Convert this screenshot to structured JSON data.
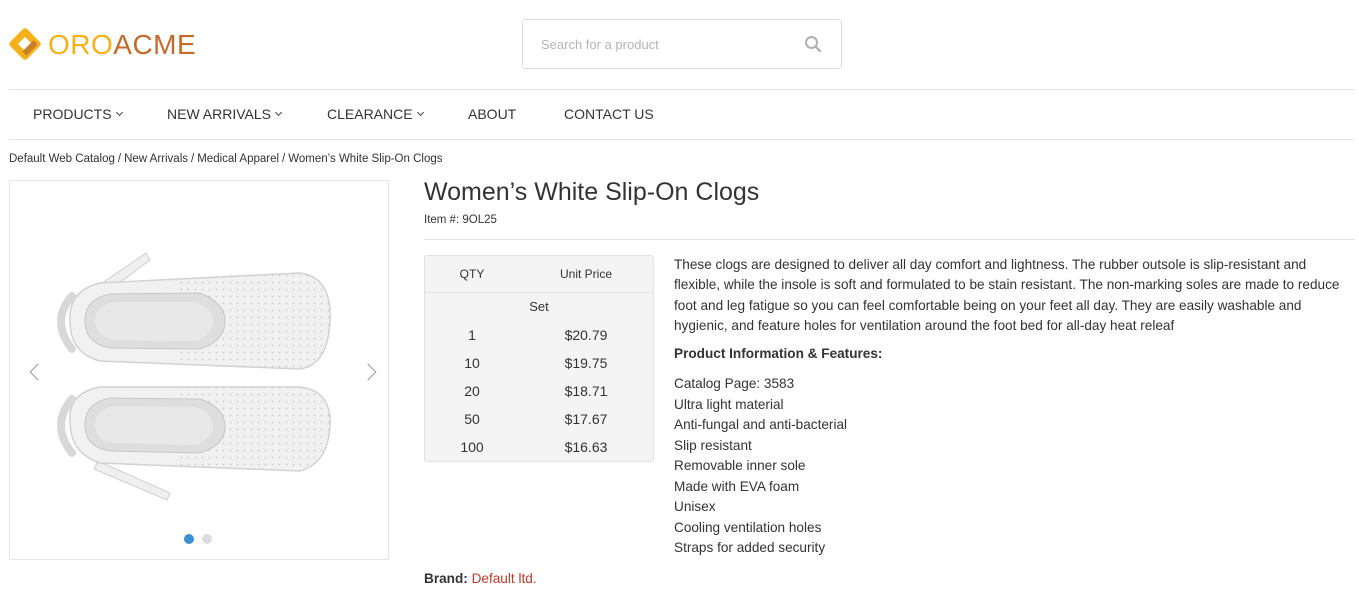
{
  "logo": {
    "part1": "ORO",
    "part2": "ACME"
  },
  "search": {
    "placeholder": "Search for a product"
  },
  "nav": {
    "products": "PRODUCTS",
    "new_arrivals": "NEW ARRIVALS",
    "clearance": "CLEARANCE",
    "about": "ABOUT",
    "contact": "CONTACT US"
  },
  "breadcrumb": [
    "Default Web Catalog",
    "New Arrivals",
    "Medical Apparel",
    "Women’s White Slip-On Clogs"
  ],
  "product": {
    "title": "Women’s White Slip-On Clogs",
    "item_label": "Item #:",
    "item_number": "9OL25",
    "description": "These clogs are designed to deliver all day comfort and lightness. The rubber outsole is slip-resistant and flexible, while the insole is soft and formulated to be stain resistant. The non-marking soles are made to reduce foot and leg fatigue so you can feel comfortable being on your feet all day. They are easily washable and hygienic, and feature holes for ventilation around the foot bed for all-day heat releaf",
    "features_title": "Product Information & Features:",
    "features": [
      "Catalog Page: 3583",
      "Ultra light material",
      "Anti-fungal and anti-bacterial",
      "Slip resistant",
      "Removable inner sole",
      "Made with EVA foam",
      "Unisex",
      "Cooling ventilation holes",
      "Straps for added security"
    ],
    "brand_label": "Brand:",
    "brand_value": "Default ltd."
  },
  "pricing": {
    "qty_header": "QTY",
    "price_header": "Unit Price",
    "unit": "Set",
    "rows": [
      {
        "qty": "1",
        "price": "$20.79"
      },
      {
        "qty": "10",
        "price": "$19.75"
      },
      {
        "qty": "20",
        "price": "$18.71"
      },
      {
        "qty": "50",
        "price": "$17.67"
      },
      {
        "qty": "100",
        "price": "$16.63"
      }
    ]
  },
  "gallery": {
    "active_slide": 1,
    "slide_count": 2
  },
  "colors": {
    "accent": "#f6b018",
    "brand": "#c46a2b",
    "link": "#c0392b",
    "dot_active": "#3b8fd3"
  }
}
